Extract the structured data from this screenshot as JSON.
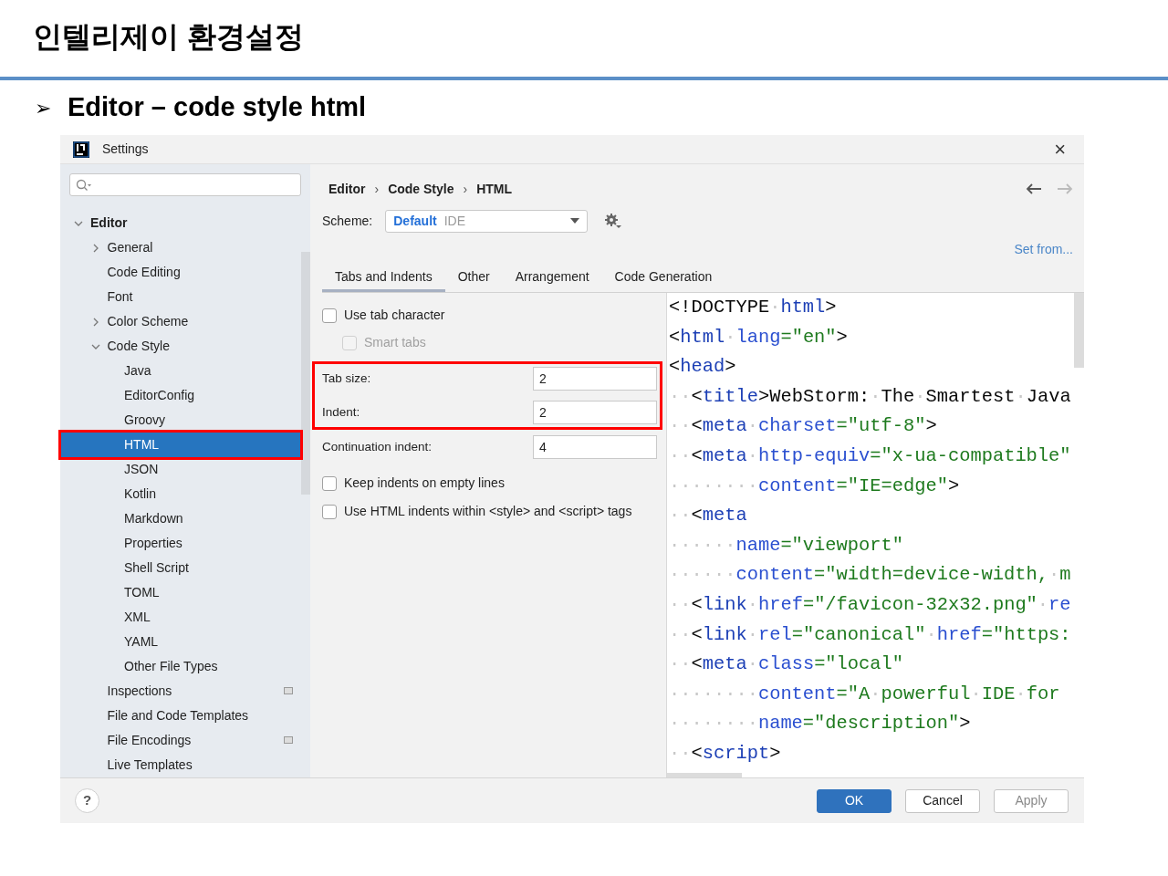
{
  "slide": {
    "title": "인텔리제이 환경설정",
    "bullet": "➢",
    "heading": "Editor – code style html"
  },
  "window": {
    "title": "Settings",
    "close": "×"
  },
  "sidebar": {
    "items": [
      {
        "label": "Editor",
        "selected": false,
        "highlighted": false,
        "badge": false,
        "expanded": true,
        "children": [
          {
            "label": "General",
            "selected": false,
            "highlighted": false,
            "badge": false,
            "expanded": false
          },
          {
            "label": "Code Editing",
            "selected": false,
            "highlighted": false,
            "badge": false
          },
          {
            "label": "Font",
            "selected": false,
            "highlighted": false,
            "badge": false
          },
          {
            "label": "Color Scheme",
            "selected": false,
            "highlighted": false,
            "badge": false,
            "expanded": false
          },
          {
            "label": "Code Style",
            "selected": false,
            "highlighted": false,
            "badge": false,
            "expanded": true,
            "children": [
              {
                "label": "Java",
                "selected": false,
                "highlighted": false,
                "badge": false
              },
              {
                "label": "EditorConfig",
                "selected": false,
                "highlighted": false,
                "badge": false
              },
              {
                "label": "Groovy",
                "selected": false,
                "highlighted": false,
                "badge": false
              },
              {
                "label": "HTML",
                "selected": true,
                "highlighted": true,
                "badge": false
              },
              {
                "label": "JSON",
                "selected": false,
                "highlighted": false,
                "badge": false
              },
              {
                "label": "Kotlin",
                "selected": false,
                "highlighted": false,
                "badge": false
              },
              {
                "label": "Markdown",
                "selected": false,
                "highlighted": false,
                "badge": false
              },
              {
                "label": "Properties",
                "selected": false,
                "highlighted": false,
                "badge": false
              },
              {
                "label": "Shell Script",
                "selected": false,
                "highlighted": false,
                "badge": false
              },
              {
                "label": "TOML",
                "selected": false,
                "highlighted": false,
                "badge": false
              },
              {
                "label": "XML",
                "selected": false,
                "highlighted": false,
                "badge": false
              },
              {
                "label": "YAML",
                "selected": false,
                "highlighted": false,
                "badge": false
              },
              {
                "label": "Other File Types",
                "selected": false,
                "highlighted": false,
                "badge": false
              }
            ]
          },
          {
            "label": "Inspections",
            "selected": false,
            "highlighted": false,
            "badge": true
          },
          {
            "label": "File and Code Templates",
            "selected": false,
            "highlighted": false,
            "badge": false
          },
          {
            "label": "File Encodings",
            "selected": false,
            "highlighted": false,
            "badge": true
          },
          {
            "label": "Live Templates",
            "selected": false,
            "highlighted": false,
            "badge": false
          }
        ]
      }
    ]
  },
  "breadcrumb": [
    {
      "label": "Editor",
      "separator": "›"
    },
    {
      "label": "Code Style",
      "separator": "›"
    },
    {
      "label": "HTML"
    }
  ],
  "scheme": {
    "label": "Scheme:",
    "value": "Default",
    "qualifier": "IDE"
  },
  "set_from": "Set from...",
  "tabs": [
    {
      "label": "Tabs and Indents",
      "selected": true
    },
    {
      "label": "Other",
      "selected": false
    },
    {
      "label": "Arrangement",
      "selected": false
    },
    {
      "label": "Code Generation",
      "selected": false
    }
  ],
  "top_options": [
    {
      "label": "Use tab character",
      "checked": false,
      "disabled": false,
      "children": [
        {
          "label": "Smart tabs",
          "checked": false,
          "disabled": true
        }
      ]
    }
  ],
  "field_groups": [
    {
      "highlighted": true,
      "fields": [
        {
          "label": "Tab size:",
          "value": "2"
        },
        {
          "label": "Indent:",
          "value": "2"
        }
      ]
    },
    {
      "highlighted": false,
      "fields": [
        {
          "label": "Continuation indent:",
          "value": "4"
        }
      ]
    }
  ],
  "bottom_options": [
    {
      "label": "Keep indents on empty lines",
      "checked": false,
      "disabled": false
    },
    {
      "label": "Use HTML indents within <style> and <script> tags",
      "checked": false,
      "disabled": false
    }
  ],
  "code_lines": [
    [
      {
        "kind": "punct",
        "text": "<!DOCTYPE"
      },
      {
        "kind": "ws",
        "text": "·"
      },
      {
        "kind": "tag",
        "text": "html"
      },
      {
        "kind": "punct",
        "text": ">"
      }
    ],
    [
      {
        "kind": "punct",
        "text": "<"
      },
      {
        "kind": "tag",
        "text": "html"
      },
      {
        "kind": "ws",
        "text": "·"
      },
      {
        "kind": "attr",
        "text": "lang"
      },
      {
        "kind": "value",
        "text": "=\"en\""
      },
      {
        "kind": "punct",
        "text": ">"
      }
    ],
    [
      {
        "kind": "punct",
        "text": "<"
      },
      {
        "kind": "tag",
        "text": "head"
      },
      {
        "kind": "punct",
        "text": ">"
      }
    ],
    [
      {
        "kind": "ws",
        "text": "··"
      },
      {
        "kind": "punct",
        "text": "<"
      },
      {
        "kind": "tag",
        "text": "title"
      },
      {
        "kind": "punct",
        "text": ">"
      },
      {
        "kind": "text",
        "text": "WebStorm:"
      },
      {
        "kind": "ws",
        "text": "·"
      },
      {
        "kind": "text",
        "text": "The"
      },
      {
        "kind": "ws",
        "text": "·"
      },
      {
        "kind": "text",
        "text": "Smartest"
      },
      {
        "kind": "ws",
        "text": "·"
      },
      {
        "kind": "text",
        "text": "Java"
      }
    ],
    [
      {
        "kind": "ws",
        "text": "··"
      },
      {
        "kind": "punct",
        "text": "<"
      },
      {
        "kind": "tag",
        "text": "meta"
      },
      {
        "kind": "ws",
        "text": "·"
      },
      {
        "kind": "attr",
        "text": "charset"
      },
      {
        "kind": "value",
        "text": "=\"utf-8\""
      },
      {
        "kind": "punct",
        "text": ">"
      }
    ],
    [
      {
        "kind": "ws",
        "text": "··"
      },
      {
        "kind": "punct",
        "text": "<"
      },
      {
        "kind": "tag",
        "text": "meta"
      },
      {
        "kind": "ws",
        "text": "·"
      },
      {
        "kind": "attr",
        "text": "http-equiv"
      },
      {
        "kind": "value",
        "text": "=\"x-ua-compatible\""
      }
    ],
    [
      {
        "kind": "ws",
        "text": "········"
      },
      {
        "kind": "attr",
        "text": "content"
      },
      {
        "kind": "value",
        "text": "=\"IE=edge\""
      },
      {
        "kind": "punct",
        "text": ">"
      }
    ],
    [
      {
        "kind": "ws",
        "text": "··"
      },
      {
        "kind": "punct",
        "text": "<"
      },
      {
        "kind": "tag",
        "text": "meta"
      }
    ],
    [
      {
        "kind": "ws",
        "text": "······"
      },
      {
        "kind": "attr",
        "text": "name"
      },
      {
        "kind": "value",
        "text": "=\"viewport\""
      }
    ],
    [
      {
        "kind": "ws",
        "text": "······"
      },
      {
        "kind": "attr",
        "text": "content"
      },
      {
        "kind": "value",
        "text": "=\"width=device-width,"
      },
      {
        "kind": "ws",
        "text": "·"
      },
      {
        "kind": "value",
        "text": "m"
      }
    ],
    [
      {
        "kind": "ws",
        "text": "··"
      },
      {
        "kind": "punct",
        "text": "<"
      },
      {
        "kind": "tag",
        "text": "link"
      },
      {
        "kind": "ws",
        "text": "·"
      },
      {
        "kind": "attr",
        "text": "href"
      },
      {
        "kind": "value",
        "text": "=\"/favicon-32x32.png\""
      },
      {
        "kind": "ws",
        "text": "·"
      },
      {
        "kind": "attr",
        "text": "re"
      }
    ],
    [
      {
        "kind": "ws",
        "text": "··"
      },
      {
        "kind": "punct",
        "text": "<"
      },
      {
        "kind": "tag",
        "text": "link"
      },
      {
        "kind": "ws",
        "text": "·"
      },
      {
        "kind": "attr",
        "text": "rel"
      },
      {
        "kind": "value",
        "text": "=\"canonical\""
      },
      {
        "kind": "ws",
        "text": "·"
      },
      {
        "kind": "attr",
        "text": "href"
      },
      {
        "kind": "value",
        "text": "=\"https:"
      }
    ],
    [
      {
        "kind": "ws",
        "text": "··"
      },
      {
        "kind": "punct",
        "text": "<"
      },
      {
        "kind": "tag",
        "text": "meta"
      },
      {
        "kind": "ws",
        "text": "·"
      },
      {
        "kind": "attr",
        "text": "class"
      },
      {
        "kind": "value",
        "text": "=\"local\""
      }
    ],
    [
      {
        "kind": "ws",
        "text": "········"
      },
      {
        "kind": "attr",
        "text": "content"
      },
      {
        "kind": "value",
        "text": "=\"A"
      },
      {
        "kind": "ws",
        "text": "·"
      },
      {
        "kind": "value",
        "text": "powerful"
      },
      {
        "kind": "ws",
        "text": "·"
      },
      {
        "kind": "value",
        "text": "IDE"
      },
      {
        "kind": "ws",
        "text": "·"
      },
      {
        "kind": "value",
        "text": "for"
      }
    ],
    [
      {
        "kind": "ws",
        "text": "········"
      },
      {
        "kind": "attr",
        "text": "name"
      },
      {
        "kind": "value",
        "text": "=\"description\""
      },
      {
        "kind": "punct",
        "text": ">"
      }
    ],
    [
      {
        "kind": "ws",
        "text": "··"
      },
      {
        "kind": "punct",
        "text": "<"
      },
      {
        "kind": "tag",
        "text": "script"
      },
      {
        "kind": "punct",
        "text": ">"
      }
    ]
  ],
  "help": "?",
  "buttons": [
    {
      "label": "OK",
      "kind": "primary",
      "disabled": false
    },
    {
      "label": "Cancel",
      "kind": "default",
      "disabled": false
    },
    {
      "label": "Apply",
      "kind": "default",
      "disabled": true
    }
  ]
}
